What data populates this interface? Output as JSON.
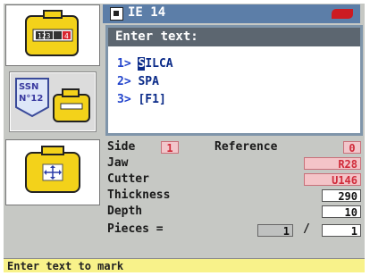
{
  "titlebar": {
    "title": "IE 14",
    "icon": "document-icon",
    "brand_icon": "silca-logo-icon",
    "brand_color": "#cc1b22"
  },
  "dialog": {
    "header": "Enter text:",
    "options": [
      {
        "num": "1>",
        "first_char": "S",
        "rest": "ILCA"
      },
      {
        "num": "2>",
        "label": "SPA"
      },
      {
        "num": "3>",
        "label": "[F1]"
      }
    ]
  },
  "key_panels": {
    "top": {
      "digits": "123",
      "digit_last": "4"
    },
    "middle": {
      "label_line1": "SSN",
      "label_line2": "N°12"
    }
  },
  "params": {
    "side_label": "Side",
    "side_value": "1",
    "reference_label": "Reference",
    "reference_value": "0",
    "jaw_label": "Jaw",
    "jaw_value": "R28",
    "cutter_label": "Cutter",
    "cutter_value": "U146",
    "thickness_label": "Thickness",
    "thickness_value": "290",
    "depth_label": "Depth",
    "depth_value": "10",
    "pieces_label": "Pieces =",
    "pieces_done": "1",
    "pieces_separator": "/",
    "pieces_total": "1"
  },
  "status": {
    "text": "Enter text to mark"
  }
}
